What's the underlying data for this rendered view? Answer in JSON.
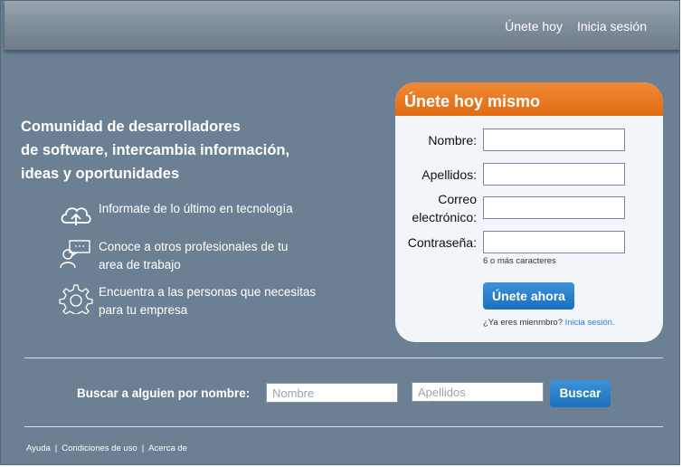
{
  "header": {
    "join_label": "Únete hoy",
    "login_label": "Inicia sesión"
  },
  "hero": {
    "line1": "Comunidad de desarrolladores",
    "line2": "de software, intercambia información,",
    "line3": "ideas y oportunidades"
  },
  "features": [
    {
      "icon": "cloud-upload-icon",
      "line1": "Informate de lo último en tecnología",
      "line2": ""
    },
    {
      "icon": "person-chat-icon",
      "line1": "Conoce a otros profesionales de tu",
      "line2": "area de trabajo"
    },
    {
      "icon": "gear-icon",
      "line1": "Encuentra a las personas que necesitas",
      "line2": "para tu empresa"
    }
  ],
  "signup": {
    "title": "Únete hoy mismo",
    "first_name_label": "Nombre:",
    "last_name_label": "Apellidos:",
    "email_label_line1": "Correo",
    "email_label_line2": "electrónico:",
    "password_label": "Contraseña:",
    "password_hint": "6 o más caracteres",
    "submit_label": "Únete ahora",
    "already_text": "¿Ya eres mienmbro?",
    "login_link": "Inicia sesión."
  },
  "search": {
    "label": "Buscar a alguien por nombre:",
    "first_placeholder": "Nombre",
    "last_placeholder": "Apellidos",
    "button_label": "Buscar"
  },
  "footer": {
    "help": "Ayuda",
    "terms": "Condiciones de uso",
    "about": "Acerca de",
    "separator": "|"
  },
  "colors": {
    "background": "#6b8193",
    "accent_orange": "#e06b14",
    "button_blue": "#1c6fbd"
  }
}
